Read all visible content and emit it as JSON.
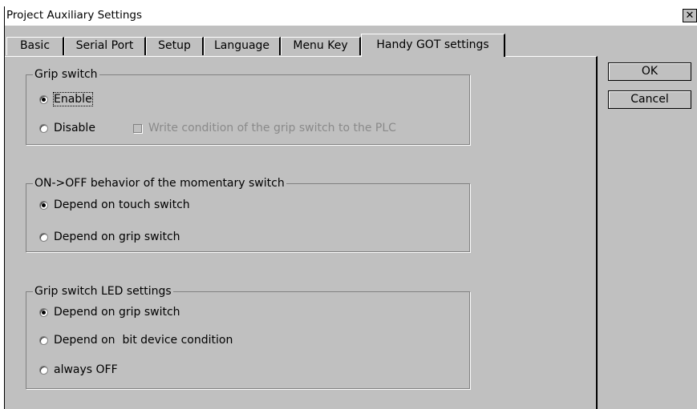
{
  "window": {
    "title": "Project Auxiliary Settings",
    "close_glyph": "✕",
    "close_icon": "close-icon"
  },
  "tabs": [
    {
      "label": "Basic"
    },
    {
      "label": "Serial Port"
    },
    {
      "label": "Setup"
    },
    {
      "label": "Language"
    },
    {
      "label": "Menu Key"
    },
    {
      "label": "Handy GOT settings",
      "selected": true
    }
  ],
  "grip_switch": {
    "title": "Grip switch",
    "options": [
      {
        "label": "Enable",
        "checked": true
      },
      {
        "label": "Disable",
        "checked": false
      }
    ],
    "write_condition": {
      "label": "Write condition of the grip switch to the PLC",
      "checked": false,
      "disabled": true
    }
  },
  "momentary_switch": {
    "title": "ON->OFF behavior of the momentary switch",
    "options": [
      {
        "label": "Depend on touch switch",
        "checked": true
      },
      {
        "label": "Depend on grip switch",
        "checked": false
      }
    ]
  },
  "led_settings": {
    "title": "Grip switch LED settings",
    "options": [
      {
        "label": "Depend on grip switch",
        "checked": true
      },
      {
        "label": "Depend on  bit device condition",
        "checked": false
      },
      {
        "label": "always OFF",
        "checked": false
      }
    ]
  },
  "buttons": {
    "ok": "OK",
    "cancel": "Cancel"
  }
}
